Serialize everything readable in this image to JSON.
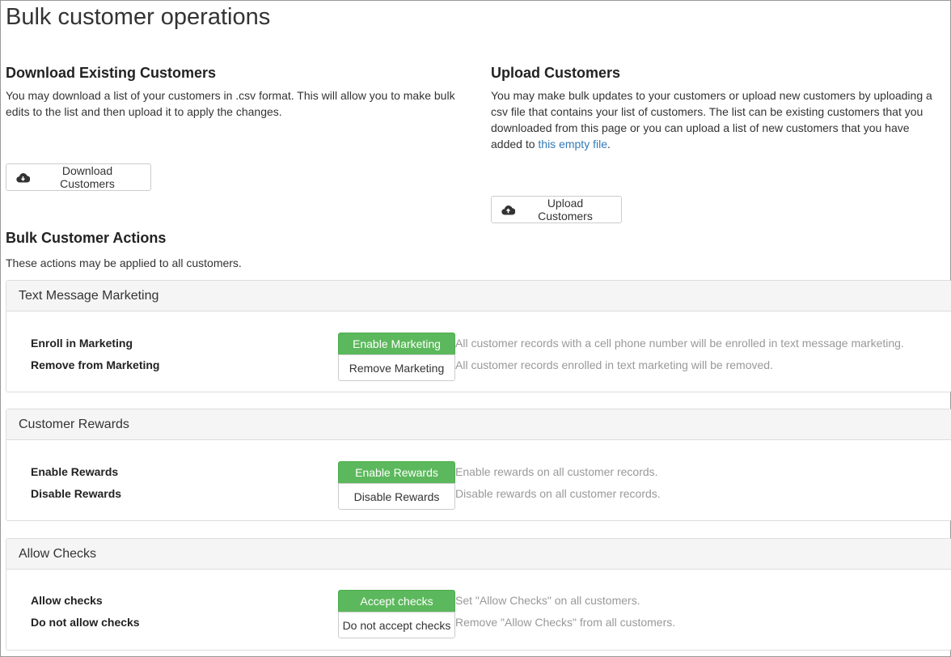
{
  "page": {
    "title": "Bulk customer operations"
  },
  "download": {
    "heading": "Download Existing Customers",
    "text": "You may download a list of your customers in .csv format. This will allow you to make bulk edits to the list and then upload it to apply the changes.",
    "button_label": "Download Customers"
  },
  "upload": {
    "heading": "Upload Customers",
    "text_before_link": "You may make bulk updates to your customers or upload new customers by uploading a csv file that contains your list of customers. The list can be existing customers that you downloaded from this page or you can upload a list of new customers that you have added to ",
    "link_text": "this empty file",
    "text_after_link": ".",
    "button_label": "Upload Customers"
  },
  "bulk_actions": {
    "heading": "Bulk Customer Actions",
    "intro": "These actions may be applied to all customers.",
    "panels": [
      {
        "title": "Text Message Marketing",
        "rows": [
          {
            "label": "Enroll in Marketing",
            "button": "Enable Marketing",
            "description": "All customer records with a cell phone number will be enrolled in text message marketing."
          },
          {
            "label": "Remove from Marketing",
            "button": "Remove Marketing",
            "description": "All customer records enrolled in text marketing will be removed."
          }
        ]
      },
      {
        "title": "Customer Rewards",
        "rows": [
          {
            "label": "Enable Rewards",
            "button": "Enable Rewards",
            "description": "Enable rewards on all customer records."
          },
          {
            "label": "Disable Rewards",
            "button": "Disable Rewards",
            "description": "Disable rewards on all customer records."
          }
        ]
      },
      {
        "title": "Allow Checks",
        "rows": [
          {
            "label": "Allow checks",
            "button": "Accept checks",
            "description": "Set \"Allow Checks\" on all customers."
          },
          {
            "label": "Do not allow checks",
            "button": "Do not accept checks",
            "description": "Remove \"Allow Checks\" from all customers."
          }
        ]
      }
    ]
  },
  "icons": {
    "download": "cloud-download-icon",
    "upload": "cloud-upload-icon"
  },
  "colors": {
    "primary_button": "#5cb85c",
    "link": "#337ab7",
    "muted_text": "#999999",
    "panel_heading_bg": "#f5f5f5"
  }
}
